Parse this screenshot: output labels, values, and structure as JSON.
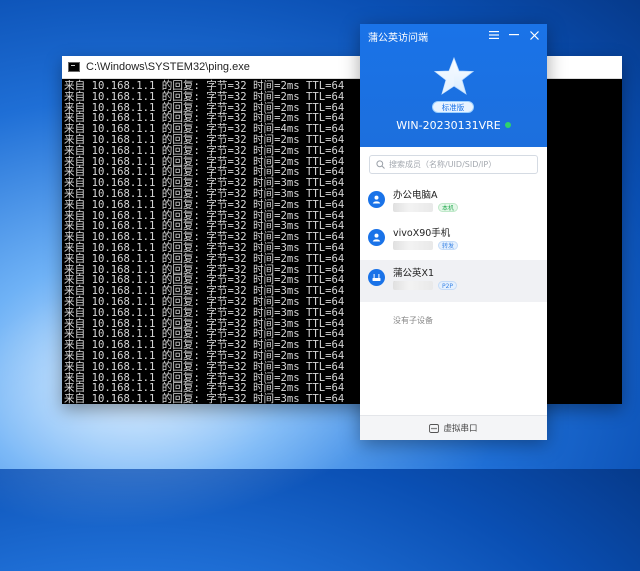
{
  "cmd": {
    "title": "C:\\Windows\\SYSTEM32\\ping.exe",
    "lines": [
      "来自 10.168.1.1 的回复: 字节=32 时间=2ms TTL=64",
      "来自 10.168.1.1 的回复: 字节=32 时间=2ms TTL=64",
      "来自 10.168.1.1 的回复: 字节=32 时间=2ms TTL=64",
      "来自 10.168.1.1 的回复: 字节=32 时间=2ms TTL=64",
      "来自 10.168.1.1 的回复: 字节=32 时间=4ms TTL=64",
      "来自 10.168.1.1 的回复: 字节=32 时间=2ms TTL=64",
      "来自 10.168.1.1 的回复: 字节=32 时间=2ms TTL=64",
      "来自 10.168.1.1 的回复: 字节=32 时间=2ms TTL=64",
      "来自 10.168.1.1 的回复: 字节=32 时间=2ms TTL=64",
      "来自 10.168.1.1 的回复: 字节=32 时间=3ms TTL=64",
      "来自 10.168.1.1 的回复: 字节=32 时间=3ms TTL=64",
      "来自 10.168.1.1 的回复: 字节=32 时间=2ms TTL=64",
      "来自 10.168.1.1 的回复: 字节=32 时间=2ms TTL=64",
      "来自 10.168.1.1 的回复: 字节=32 时间=3ms TTL=64",
      "来自 10.168.1.1 的回复: 字节=32 时间=2ms TTL=64",
      "来自 10.168.1.1 的回复: 字节=32 时间=3ms TTL=64",
      "来自 10.168.1.1 的回复: 字节=32 时间=2ms TTL=64",
      "来自 10.168.1.1 的回复: 字节=32 时间=2ms TTL=64",
      "来自 10.168.1.1 的回复: 字节=32 时间=2ms TTL=64",
      "来自 10.168.1.1 的回复: 字节=32 时间=3ms TTL=64",
      "来自 10.168.1.1 的回复: 字节=32 时间=2ms TTL=64",
      "来自 10.168.1.1 的回复: 字节=32 时间=3ms TTL=64",
      "来自 10.168.1.1 的回复: 字节=32 时间=3ms TTL=64",
      "来自 10.168.1.1 的回复: 字节=32 时间=2ms TTL=64",
      "来自 10.168.1.1 的回复: 字节=32 时间=2ms TTL=64",
      "来自 10.168.1.1 的回复: 字节=32 时间=2ms TTL=64",
      "来自 10.168.1.1 的回复: 字节=32 时间=3ms TTL=64",
      "来自 10.168.1.1 的回复: 字节=32 时间=2ms TTL=64",
      "来自 10.168.1.1 的回复: 字节=32 时间=2ms TTL=64",
      "来自 10.168.1.1 的回复: 字节=32 时间=3ms TTL=64"
    ]
  },
  "client": {
    "title": "蒲公英访问端",
    "edition": "标准版",
    "device_name": "WIN-20230131VRE",
    "search_placeholder": "搜索成员（名称/UID/SID/IP）",
    "devices": [
      {
        "name": "办公电脑A",
        "ip_prefix": "1",
        "tag": "本机",
        "tag_type": "local"
      },
      {
        "name": "vivoX90手机",
        "ip_prefix": "1",
        "tag": "转发",
        "tag_type": "relay"
      },
      {
        "name": "蒲公英X1",
        "ip_prefix": "1",
        "tag": "P2P",
        "tag_type": "p2p"
      }
    ],
    "sub_device_note": "没有子设备",
    "footer_label": "虚拟串口"
  },
  "colors": {
    "accent": "#1a73e8",
    "online": "#2ed36b"
  }
}
